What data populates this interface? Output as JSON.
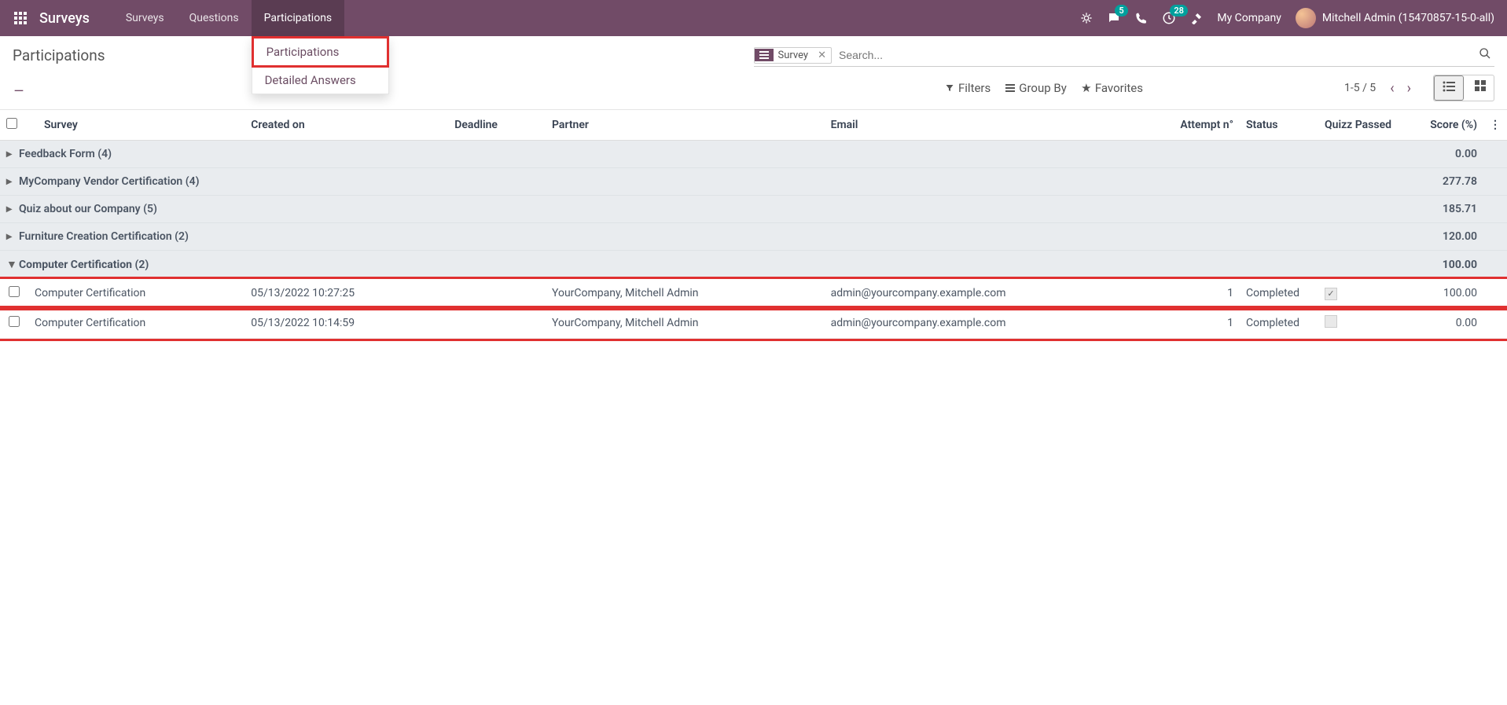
{
  "navbar": {
    "app_title": "Surveys",
    "menu": [
      "Surveys",
      "Questions",
      "Participations"
    ],
    "active_menu": 2,
    "dropdown": {
      "items": [
        "Participations",
        "Detailed Answers"
      ]
    },
    "badges": {
      "messages": "5",
      "activities": "28"
    },
    "company": "My Company",
    "user": "Mitchell Admin (15470857-15-0-all)"
  },
  "control": {
    "breadcrumb": "Participations",
    "search": {
      "facet_label": "Survey",
      "placeholder": "Search..."
    },
    "filters_label": "Filters",
    "groupby_label": "Group By",
    "favorites_label": "Favorites",
    "pager": "1-5 / 5"
  },
  "table": {
    "headers": {
      "survey": "Survey",
      "created": "Created on",
      "deadline": "Deadline",
      "partner": "Partner",
      "email": "Email",
      "attempt": "Attempt n°",
      "status": "Status",
      "quiz": "Quizz Passed",
      "score": "Score (%)"
    },
    "groups": [
      {
        "label": "Feedback Form (4)",
        "score": "0.00",
        "expanded": false
      },
      {
        "label": "MyCompany Vendor Certification (4)",
        "score": "277.78",
        "expanded": false
      },
      {
        "label": "Quiz about our Company (5)",
        "score": "185.71",
        "expanded": false
      },
      {
        "label": "Furniture Creation Certification (2)",
        "score": "120.00",
        "expanded": false
      },
      {
        "label": "Computer Certification (2)",
        "score": "100.00",
        "expanded": true
      }
    ],
    "rows": [
      {
        "survey": "Computer Certification",
        "created": "05/13/2022 10:27:25",
        "deadline": "",
        "partner": "YourCompany, Mitchell Admin",
        "email": "admin@yourcompany.example.com",
        "attempt": "1",
        "status": "Completed",
        "quiz_passed": true,
        "score": "100.00"
      },
      {
        "survey": "Computer Certification",
        "created": "05/13/2022 10:14:59",
        "deadline": "",
        "partner": "YourCompany, Mitchell Admin",
        "email": "admin@yourcompany.example.com",
        "attempt": "1",
        "status": "Completed",
        "quiz_passed": false,
        "score": "0.00"
      }
    ]
  }
}
